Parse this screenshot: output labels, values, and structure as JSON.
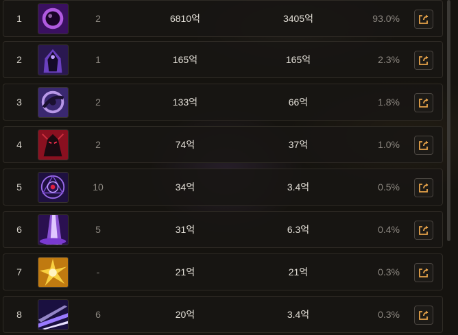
{
  "rows": [
    {
      "rank": "1",
      "level": "2",
      "total": "6810억",
      "per_hit": "3405억",
      "percent": "93.0%",
      "icon": "dark-orb-skill-icon",
      "color": "#7a2fb0"
    },
    {
      "rank": "2",
      "level": "1",
      "total": "165억",
      "per_hit": "165억",
      "percent": "2.3%",
      "icon": "hooded-figure-skill-icon",
      "color": "#4a2a8a"
    },
    {
      "rank": "3",
      "level": "2",
      "total": "133억",
      "per_hit": "66억",
      "percent": "1.8%",
      "icon": "dark-swirl-skill-icon",
      "color": "#5a3a9a"
    },
    {
      "rank": "4",
      "level": "2",
      "total": "74억",
      "per_hit": "37억",
      "percent": "1.0%",
      "icon": "demon-knight-skill-icon",
      "color": "#9a1a2a"
    },
    {
      "rank": "5",
      "level": "10",
      "total": "34억",
      "per_hit": "3.4억",
      "percent": "0.5%",
      "icon": "sigil-eye-skill-icon",
      "color": "#5a2aa0"
    },
    {
      "rank": "6",
      "level": "5",
      "total": "31억",
      "per_hit": "6.3억",
      "percent": "0.4%",
      "icon": "purple-pillar-skill-icon",
      "color": "#8a3ad0"
    },
    {
      "rank": "7",
      "level": "-",
      "total": "21억",
      "per_hit": "21억",
      "percent": "0.3%",
      "icon": "golden-burst-skill-icon",
      "color": "#d89a20"
    },
    {
      "rank": "8",
      "level": "6",
      "total": "20억",
      "per_hit": "3.4억",
      "percent": "0.3%",
      "icon": "violet-slash-skill-icon",
      "color": "#4a2ab0"
    }
  ],
  "share_icon": "share-icon",
  "colors": {
    "accent": "#e8a44a",
    "text": "#e4e0d8",
    "muted": "#8c8780"
  }
}
